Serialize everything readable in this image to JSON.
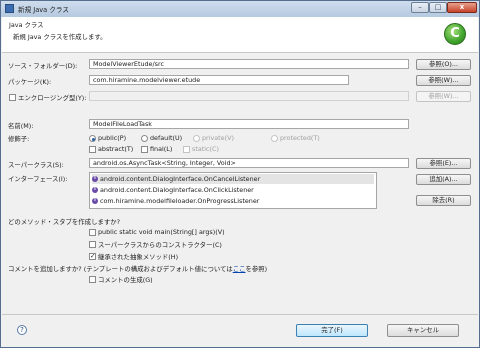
{
  "window": {
    "title": "新規 Java クラス",
    "buttons": {
      "minimize": "–",
      "maximize": "□",
      "close": "x"
    }
  },
  "header": {
    "title": "Java クラス",
    "subtitle": "新規 Java クラスを作成します。"
  },
  "source_folder": {
    "label": "ソース・フォルダー(D):",
    "value": "ModelViewerEtude/src",
    "browse": "参照(O)..."
  },
  "package": {
    "label": "パッケージ(K):",
    "value": "com.hiramine.modelviewer.etude",
    "browse": "参照(W)..."
  },
  "enclosing": {
    "label": "エンクロージング型(Y):",
    "value": "",
    "browse": "参照(W)..."
  },
  "name": {
    "label": "名前(M):",
    "value": "ModelFileLoadTask"
  },
  "modifiers": {
    "label": "修飾子:",
    "access": [
      {
        "label": "public(P)",
        "selected": true,
        "enabled": true
      },
      {
        "label": "default(U)",
        "selected": false,
        "enabled": true
      },
      {
        "label": "private(V)",
        "selected": false,
        "enabled": false
      },
      {
        "label": "protected(T)",
        "selected": false,
        "enabled": false
      }
    ],
    "other": [
      {
        "label": "abstract(T)",
        "checked": false,
        "enabled": true
      },
      {
        "label": "final(L)",
        "checked": false,
        "enabled": true
      },
      {
        "label": "static(C)",
        "checked": false,
        "enabled": false
      }
    ]
  },
  "superclass": {
    "label": "スーパークラス(S):",
    "value": "android.os.AsyncTask<String, Integer, Void>",
    "browse": "参照(E)..."
  },
  "interfaces": {
    "label": "インターフェース(I):",
    "items": [
      "android.content.DialogInterface.OnCancelListener",
      "android.content.DialogInterface.OnClickListener",
      "com.hiramine.modelfileloader.OnProgressListener"
    ],
    "add": "追加(A)...",
    "remove": "除去(R)"
  },
  "stubs": {
    "question": "どのメソッド・スタブを作成しますか?",
    "options": [
      {
        "label": "public static void main(String[] args)(V)",
        "checked": false
      },
      {
        "label": "スーパークラスからのコンストラクター(C)",
        "checked": false
      },
      {
        "label": "継承された抽象メソッド(H)",
        "checked": true
      }
    ]
  },
  "comments": {
    "question_pre": "コメントを追加しますか? (テンプレートの構成およびデフォルト値については",
    "link": "ここ",
    "question_post": "を参照)",
    "option": {
      "label": "コメントの生成(G)",
      "checked": false
    }
  },
  "footer": {
    "help": "?",
    "finish": "完了(F)",
    "cancel": "キャンセル"
  }
}
